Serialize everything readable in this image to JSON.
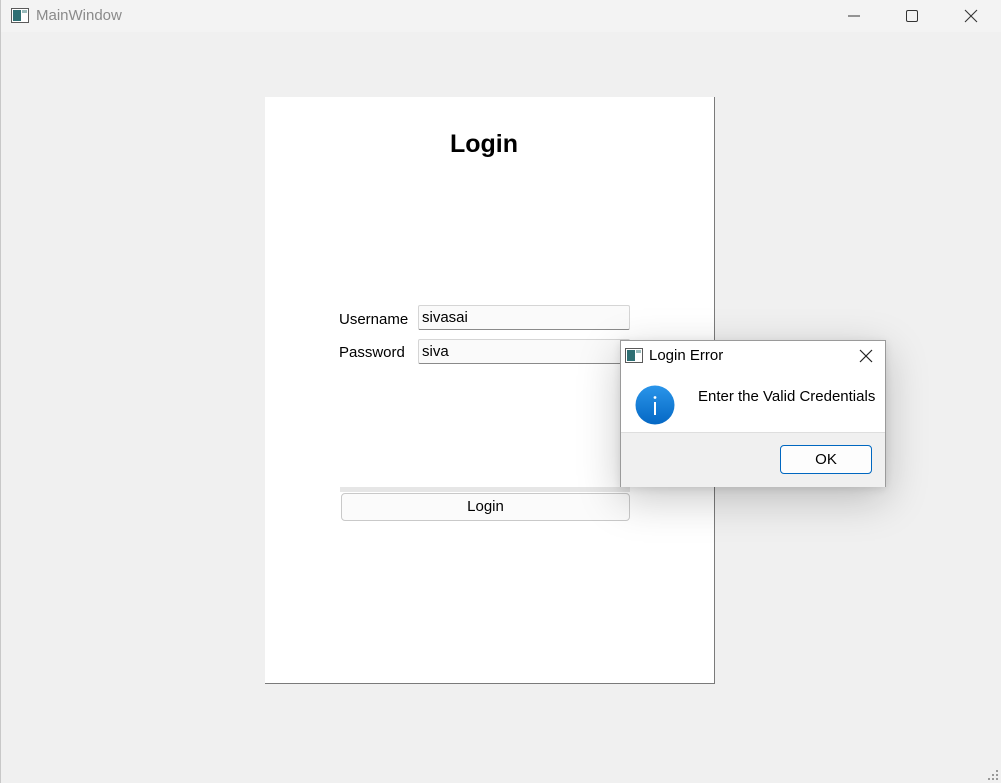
{
  "window": {
    "title": "MainWindow",
    "app_icon": "app-window-icon",
    "controls": [
      "minimize-icon",
      "maximize-icon",
      "close-icon"
    ]
  },
  "form": {
    "heading": "Login",
    "username_label": "Username",
    "username_value": "sivasai",
    "password_label": "Password",
    "password_value": "siva",
    "login_button": "Login"
  },
  "dialog": {
    "title": "Login Error",
    "message": "Enter the Valid Credentials",
    "ok_button": "OK",
    "icon": "info-icon",
    "icon_color": "#0a7bd8"
  }
}
